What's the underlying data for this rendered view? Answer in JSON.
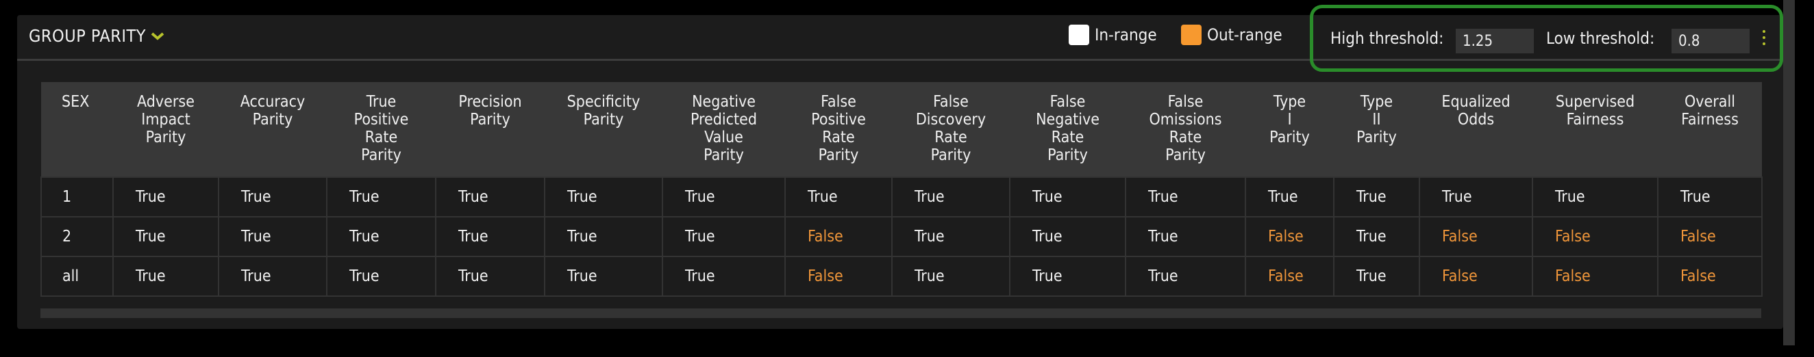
{
  "panel": {
    "title": "GROUP PARITY",
    "legend": [
      {
        "label": "In-range",
        "color": "#ffffff"
      },
      {
        "label": "Out-range",
        "color": "#f7992f"
      }
    ],
    "high_threshold_label": "High threshold:",
    "high_threshold_value": "1.25",
    "low_threshold_label": "Low threshold:",
    "low_threshold_value": "0.8",
    "accent_color": "#b7c32c",
    "out_range_color": "#f0963a"
  },
  "table": {
    "columns": [
      "SEX",
      "Adverse\nImpact\nParity",
      "Accuracy\nParity",
      "True\nPositive\nRate\nParity",
      "Precision\nParity",
      "Specificity\nParity",
      "Negative\nPredicted\nValue\nParity",
      "False\nPositive\nRate\nParity",
      "False\nDiscovery\nRate\nParity",
      "False\nNegative\nRate\nParity",
      "False\nOmissions\nRate\nParity",
      "Type\nI\nParity",
      "Type\nII\nParity",
      "Equalized\nOdds",
      "Supervised\nFairness",
      "Overall\nFairness"
    ],
    "rows": [
      [
        "1",
        "True",
        "True",
        "True",
        "True",
        "True",
        "True",
        "True",
        "True",
        "True",
        "True",
        "True",
        "True",
        "True",
        "True",
        "True"
      ],
      [
        "2",
        "True",
        "True",
        "True",
        "True",
        "True",
        "True",
        "False",
        "True",
        "True",
        "True",
        "False",
        "True",
        "False",
        "False",
        "False"
      ],
      [
        "all",
        "True",
        "True",
        "True",
        "True",
        "True",
        "True",
        "False",
        "True",
        "True",
        "True",
        "False",
        "True",
        "False",
        "False",
        "False"
      ]
    ]
  }
}
